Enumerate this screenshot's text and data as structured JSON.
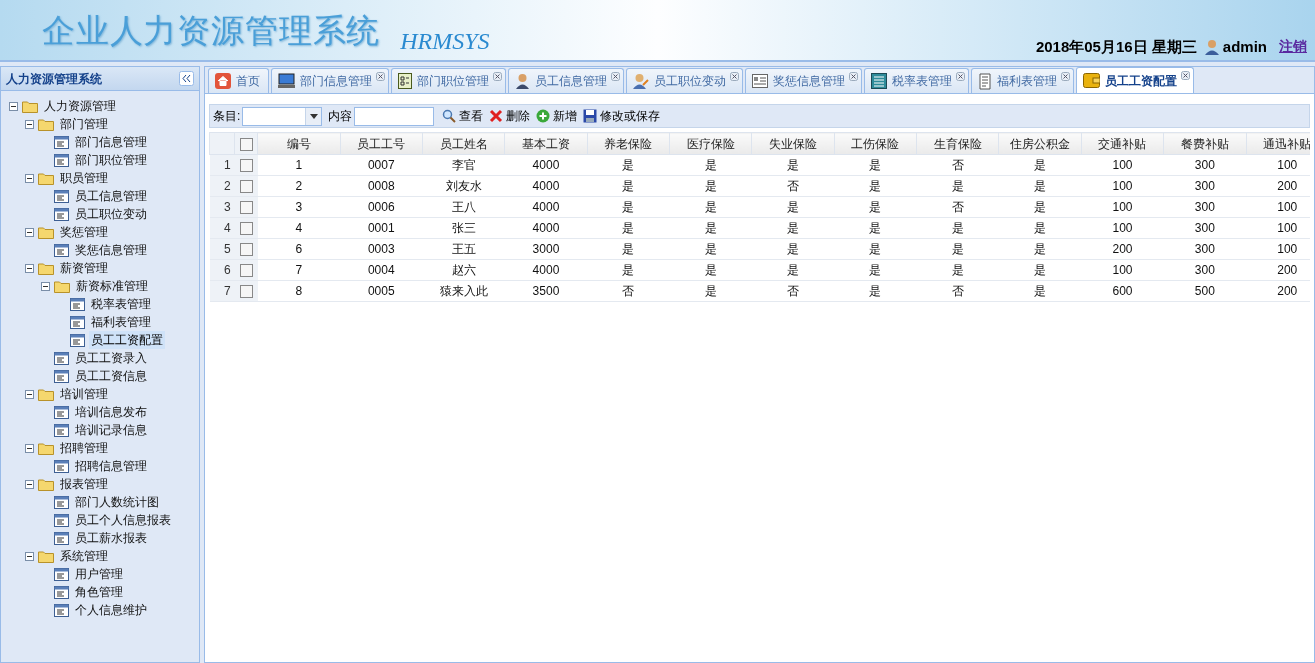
{
  "header": {
    "title": "企业人力资源管理系统",
    "subtitle": "HRMSYS",
    "date": "2018年05月16日 星期三",
    "user": "admin",
    "logout": "注销"
  },
  "sidebar": {
    "title": "人力资源管理系统",
    "tree": [
      {
        "label": "人力资源管理",
        "expanded": true,
        "selected": false,
        "children": [
          {
            "label": "部门管理",
            "expanded": true,
            "selected": false,
            "children": [
              {
                "label": "部门信息管理",
                "selected": false
              },
              {
                "label": "部门职位管理",
                "selected": false
              }
            ]
          },
          {
            "label": "职员管理",
            "expanded": true,
            "selected": false,
            "children": [
              {
                "label": "员工信息管理",
                "selected": false
              },
              {
                "label": "员工职位变动",
                "selected": false
              }
            ]
          },
          {
            "label": "奖惩管理",
            "expanded": true,
            "selected": false,
            "children": [
              {
                "label": "奖惩信息管理",
                "selected": false
              }
            ]
          },
          {
            "label": "薪资管理",
            "expanded": true,
            "selected": false,
            "children": [
              {
                "label": "薪资标准管理",
                "expanded": true,
                "selected": false,
                "children": [
                  {
                    "label": "税率表管理",
                    "selected": false
                  },
                  {
                    "label": "福利表管理",
                    "selected": false
                  },
                  {
                    "label": "员工工资配置",
                    "selected": true
                  }
                ]
              },
              {
                "label": "员工工资录入",
                "selected": false
              },
              {
                "label": "员工工资信息",
                "selected": false
              }
            ]
          },
          {
            "label": "培训管理",
            "expanded": true,
            "selected": false,
            "children": [
              {
                "label": "培训信息发布",
                "selected": false
              },
              {
                "label": "培训记录信息",
                "selected": false
              }
            ]
          },
          {
            "label": "招聘管理",
            "expanded": true,
            "selected": false,
            "children": [
              {
                "label": "招聘信息管理",
                "selected": false
              }
            ]
          },
          {
            "label": "报表管理",
            "expanded": true,
            "selected": false,
            "children": [
              {
                "label": "部门人数统计图",
                "selected": false
              },
              {
                "label": "员工个人信息报表",
                "selected": false
              },
              {
                "label": "员工薪水报表",
                "selected": false
              }
            ]
          },
          {
            "label": "系统管理",
            "expanded": true,
            "selected": false,
            "children": [
              {
                "label": "用户管理",
                "selected": false
              },
              {
                "label": "角色管理",
                "selected": false
              },
              {
                "label": "个人信息维护",
                "selected": false
              }
            ]
          }
        ]
      }
    ]
  },
  "tabs": [
    {
      "label": "首页",
      "selected": false,
      "closable": false
    },
    {
      "label": "部门信息管理",
      "selected": false,
      "closable": true
    },
    {
      "label": "部门职位管理",
      "selected": false,
      "closable": true
    },
    {
      "label": "员工信息管理",
      "selected": false,
      "closable": true
    },
    {
      "label": "员工职位变动",
      "selected": false,
      "closable": true
    },
    {
      "label": "奖惩信息管理",
      "selected": false,
      "closable": true
    },
    {
      "label": "税率表管理",
      "selected": false,
      "closable": true
    },
    {
      "label": "福利表管理",
      "selected": false,
      "closable": true
    },
    {
      "label": "员工工资配置",
      "selected": true,
      "closable": true
    }
  ],
  "toolbar": {
    "field_label": "条目:",
    "content_label": "内容",
    "buttons": [
      "查看",
      "删除",
      "新增",
      "修改或保存"
    ]
  },
  "table": {
    "all_checked": false,
    "columns": [
      "编号",
      "员工工号",
      "员工姓名",
      "基本工资",
      "养老保险",
      "医疗保险",
      "失业保险",
      "工伤保险",
      "生育保险",
      "住房公积金",
      "交通补贴",
      "餐费补贴",
      "通迅补贴"
    ],
    "rows": [
      {
        "index": "1",
        "checked": false,
        "cells": [
          "1",
          "0007",
          "李官",
          "4000",
          "是",
          "是",
          "是",
          "是",
          "否",
          "是",
          "100",
          "300",
          "100"
        ]
      },
      {
        "index": "2",
        "checked": false,
        "cells": [
          "2",
          "0008",
          "刘友水",
          "4000",
          "是",
          "是",
          "否",
          "是",
          "是",
          "是",
          "100",
          "300",
          "200"
        ]
      },
      {
        "index": "3",
        "checked": false,
        "cells": [
          "3",
          "0006",
          "王八",
          "4000",
          "是",
          "是",
          "是",
          "是",
          "否",
          "是",
          "100",
          "300",
          "100"
        ]
      },
      {
        "index": "4",
        "checked": false,
        "cells": [
          "4",
          "0001",
          "张三",
          "4000",
          "是",
          "是",
          "是",
          "是",
          "是",
          "是",
          "100",
          "300",
          "100"
        ]
      },
      {
        "index": "5",
        "checked": false,
        "cells": [
          "6",
          "0003",
          "王五",
          "3000",
          "是",
          "是",
          "是",
          "是",
          "是",
          "是",
          "200",
          "300",
          "100"
        ]
      },
      {
        "index": "6",
        "checked": false,
        "cells": [
          "7",
          "0004",
          "赵六",
          "4000",
          "是",
          "是",
          "是",
          "是",
          "是",
          "是",
          "100",
          "300",
          "200"
        ]
      },
      {
        "index": "7",
        "checked": false,
        "cells": [
          "8",
          "0005",
          "猿来入此",
          "3500",
          "否",
          "是",
          "否",
          "是",
          "否",
          "是",
          "600",
          "500",
          "200"
        ]
      }
    ]
  }
}
